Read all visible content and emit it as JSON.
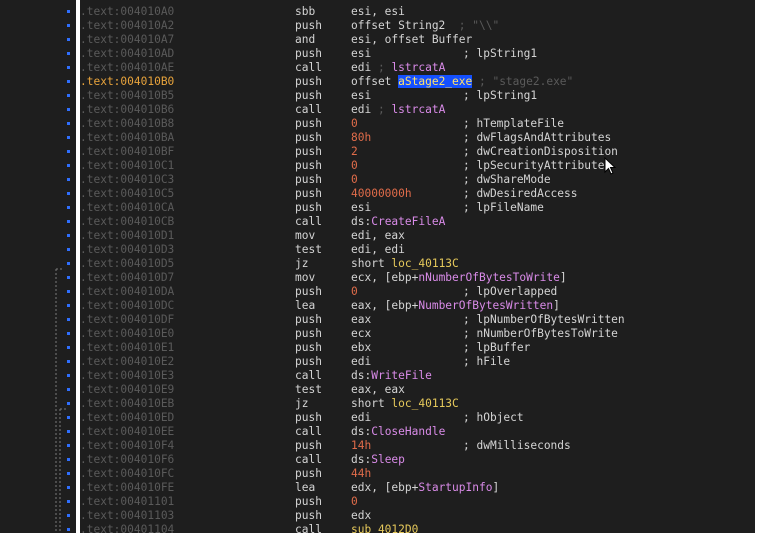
{
  "colors": {
    "background": "#1e1e1e",
    "address": "#5a5a5a",
    "current_address": "#e7a33c",
    "text": "#d4d4d4",
    "number": "#e06c4a",
    "symbol": "#d98be8",
    "label": "#e6c95b",
    "highlight_bg": "#1450ff",
    "highlight_fg": "#ffe16b",
    "dot": "#2f6fff"
  },
  "lines": [
    {
      "addr": ".text:004010A0",
      "mn": "sbb",
      "ops": [
        {
          "t": "esi, esi"
        }
      ],
      "cm": []
    },
    {
      "addr": ".text:004010A2",
      "mn": "push",
      "ops": [
        {
          "t": "offset String2"
        },
        {
          "t": "  ; \"\\\\\"",
          "c": "dim"
        }
      ],
      "cm": []
    },
    {
      "addr": ".text:004010A7",
      "mn": "and",
      "ops": [
        {
          "t": "esi, offset Buffer"
        }
      ],
      "cm": []
    },
    {
      "addr": ".text:004010AD",
      "mn": "push",
      "ops": [
        {
          "t": "esi"
        }
      ],
      "cm": [
        {
          "t": "; lpString1"
        }
      ]
    },
    {
      "addr": ".text:004010AE",
      "mn": "call",
      "ops": [
        {
          "t": "edi"
        },
        {
          "t": " ; ",
          "c": "dim"
        },
        {
          "t": "lstrcatA",
          "c": "sym"
        }
      ],
      "cm": []
    },
    {
      "addr": ".text:004010B0",
      "current": true,
      "mn": "push",
      "ops": [
        {
          "t": "offset "
        },
        {
          "t": "aStage2_exe",
          "c": "hl"
        },
        {
          "t": " ; \"stage2.exe\"",
          "c": "dim"
        }
      ],
      "cm": []
    },
    {
      "addr": ".text:004010B5",
      "mn": "push",
      "ops": [
        {
          "t": "esi"
        }
      ],
      "cm": [
        {
          "t": "; lpString1"
        }
      ]
    },
    {
      "addr": ".text:004010B6",
      "mn": "call",
      "ops": [
        {
          "t": "edi"
        },
        {
          "t": " ; ",
          "c": "dim"
        },
        {
          "t": "lstrcatA",
          "c": "sym"
        }
      ],
      "cm": []
    },
    {
      "addr": ".text:004010B8",
      "mn": "push",
      "ops": [
        {
          "t": "0",
          "c": "num"
        }
      ],
      "cm": [
        {
          "t": "; hTemplateFile"
        }
      ]
    },
    {
      "addr": ".text:004010BA",
      "mn": "push",
      "ops": [
        {
          "t": "80h",
          "c": "num"
        }
      ],
      "cm": [
        {
          "t": "; dwFlagsAndAttributes"
        }
      ]
    },
    {
      "addr": ".text:004010BF",
      "mn": "push",
      "ops": [
        {
          "t": "2",
          "c": "num"
        }
      ],
      "cm": [
        {
          "t": "; dwCreationDisposition"
        }
      ]
    },
    {
      "addr": ".text:004010C1",
      "mn": "push",
      "ops": [
        {
          "t": "0",
          "c": "num"
        }
      ],
      "cm": [
        {
          "t": "; lpSecurityAttributes"
        }
      ]
    },
    {
      "addr": ".text:004010C3",
      "mn": "push",
      "ops": [
        {
          "t": "0",
          "c": "num"
        }
      ],
      "cm": [
        {
          "t": "; dwShareMode"
        }
      ]
    },
    {
      "addr": ".text:004010C5",
      "mn": "push",
      "ops": [
        {
          "t": "40000000h",
          "c": "num"
        }
      ],
      "cm": [
        {
          "t": "; dwDesiredAccess"
        }
      ]
    },
    {
      "addr": ".text:004010CA",
      "mn": "push",
      "ops": [
        {
          "t": "esi"
        }
      ],
      "cm": [
        {
          "t": "; lpFileName"
        }
      ]
    },
    {
      "addr": ".text:004010CB",
      "mn": "call",
      "ops": [
        {
          "t": "ds:"
        },
        {
          "t": "CreateFileA",
          "c": "sym"
        }
      ],
      "cm": []
    },
    {
      "addr": ".text:004010D1",
      "mn": "mov",
      "ops": [
        {
          "t": "edi, eax"
        }
      ],
      "cm": []
    },
    {
      "addr": ".text:004010D3",
      "mn": "test",
      "ops": [
        {
          "t": "edi, edi"
        }
      ],
      "cm": []
    },
    {
      "addr": ".text:004010D5",
      "mn": "jz",
      "ops": [
        {
          "t": "short "
        },
        {
          "t": "loc_40113C",
          "c": "lbl"
        }
      ],
      "cm": []
    },
    {
      "addr": ".text:004010D7",
      "mn": "mov",
      "ops": [
        {
          "t": "ecx, [ebp+"
        },
        {
          "t": "nNumberOfBytesToWrite",
          "c": "sym"
        },
        {
          "t": "]"
        }
      ],
      "cm": []
    },
    {
      "addr": ".text:004010DA",
      "mn": "push",
      "ops": [
        {
          "t": "0",
          "c": "num"
        }
      ],
      "cm": [
        {
          "t": "; lpOverlapped"
        }
      ]
    },
    {
      "addr": ".text:004010DC",
      "mn": "lea",
      "ops": [
        {
          "t": "eax, [ebp+"
        },
        {
          "t": "NumberOfBytesWritten",
          "c": "sym"
        },
        {
          "t": "]"
        }
      ],
      "cm": []
    },
    {
      "addr": ".text:004010DF",
      "mn": "push",
      "ops": [
        {
          "t": "eax"
        }
      ],
      "cm": [
        {
          "t": "; lpNumberOfBytesWritten"
        }
      ]
    },
    {
      "addr": ".text:004010E0",
      "mn": "push",
      "ops": [
        {
          "t": "ecx"
        }
      ],
      "cm": [
        {
          "t": "; nNumberOfBytesToWrite"
        }
      ]
    },
    {
      "addr": ".text:004010E1",
      "mn": "push",
      "ops": [
        {
          "t": "ebx"
        }
      ],
      "cm": [
        {
          "t": "; lpBuffer"
        }
      ]
    },
    {
      "addr": ".text:004010E2",
      "mn": "push",
      "ops": [
        {
          "t": "edi"
        }
      ],
      "cm": [
        {
          "t": "; hFile"
        }
      ]
    },
    {
      "addr": ".text:004010E3",
      "mn": "call",
      "ops": [
        {
          "t": "ds:"
        },
        {
          "t": "WriteFile",
          "c": "sym"
        }
      ],
      "cm": []
    },
    {
      "addr": ".text:004010E9",
      "mn": "test",
      "ops": [
        {
          "t": "eax, eax"
        }
      ],
      "cm": []
    },
    {
      "addr": ".text:004010EB",
      "mn": "jz",
      "ops": [
        {
          "t": "short "
        },
        {
          "t": "loc_40113C",
          "c": "lbl"
        }
      ],
      "cm": []
    },
    {
      "addr": ".text:004010ED",
      "mn": "push",
      "ops": [
        {
          "t": "edi"
        }
      ],
      "cm": [
        {
          "t": "; hObject"
        }
      ]
    },
    {
      "addr": ".text:004010EE",
      "mn": "call",
      "ops": [
        {
          "t": "ds:"
        },
        {
          "t": "CloseHandle",
          "c": "sym"
        }
      ],
      "cm": []
    },
    {
      "addr": ".text:004010F4",
      "mn": "push",
      "ops": [
        {
          "t": "14h",
          "c": "num"
        }
      ],
      "cm": [
        {
          "t": "; dwMilliseconds"
        }
      ]
    },
    {
      "addr": ".text:004010F6",
      "mn": "call",
      "ops": [
        {
          "t": "ds:"
        },
        {
          "t": "Sleep",
          "c": "sym"
        }
      ],
      "cm": []
    },
    {
      "addr": ".text:004010FC",
      "mn": "push",
      "ops": [
        {
          "t": "44h",
          "c": "num"
        }
      ],
      "cm": []
    },
    {
      "addr": ".text:004010FE",
      "mn": "lea",
      "ops": [
        {
          "t": "edx, [ebp+"
        },
        {
          "t": "StartupInfo",
          "c": "sym"
        },
        {
          "t": "]"
        }
      ],
      "cm": []
    },
    {
      "addr": ".text:00401101",
      "mn": "push",
      "ops": [
        {
          "t": "0",
          "c": "num"
        }
      ],
      "cm": []
    },
    {
      "addr": ".text:00401103",
      "mn": "push",
      "ops": [
        {
          "t": "edx"
        }
      ],
      "cm": []
    },
    {
      "addr": ".text:00401104",
      "mn": "call",
      "ops": [
        {
          "t": "sub_4012D0",
          "c": "lbl"
        }
      ],
      "cm": []
    }
  ]
}
